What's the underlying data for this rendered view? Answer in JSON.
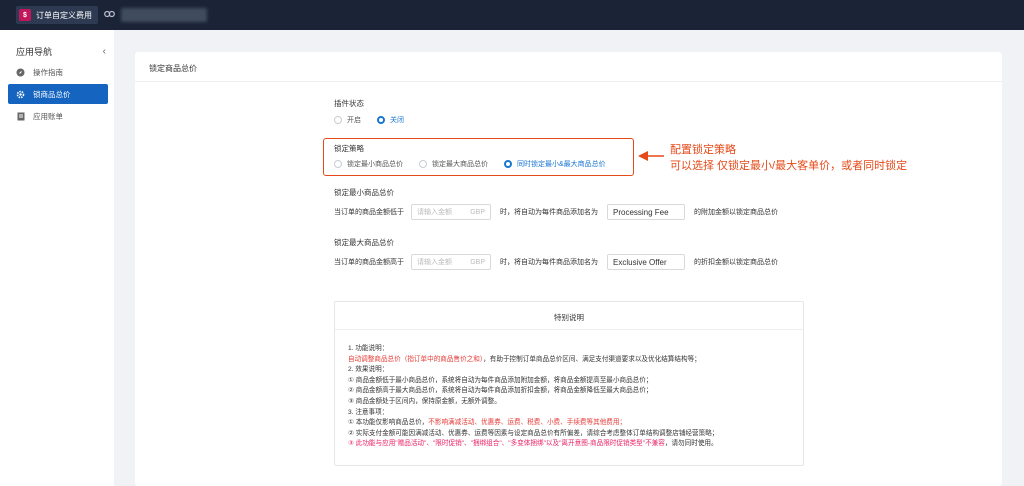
{
  "topbar": {
    "app_logo": "$",
    "app_title": "订单自定义费用",
    "link_icon": "link-icon"
  },
  "sidebar": {
    "title": "应用导航",
    "collapse_glyph": "‹",
    "items": [
      {
        "label": "操作指南",
        "icon": "guide-icon"
      },
      {
        "label": "锁商品总价",
        "icon": "gear-icon",
        "active": true
      },
      {
        "label": "应用账单",
        "icon": "bill-icon"
      }
    ]
  },
  "card": {
    "title": "锁定商品总价",
    "plugin_status": {
      "label": "插件状态",
      "options": [
        "开启",
        "关闭"
      ],
      "selected": "关闭"
    },
    "strategy": {
      "label": "锁定策略",
      "options": [
        "锁定最小商品总价",
        "锁定最大商品总价",
        "同时锁定最小&最大商品总价"
      ],
      "selected": "同时锁定最小&最大商品总价"
    },
    "min_section": {
      "label": "锁定最小商品总价",
      "prefix": "当订单的商品金额低于",
      "amount_placeholder": "请输入金额",
      "currency": "GBP",
      "middle": "时，将自动为每件商品添加名为",
      "fee_name": "Processing Fee",
      "suffix": "的附加金额以锁定商品总价"
    },
    "max_section": {
      "label": "锁定最大商品总价",
      "prefix": "当订单的商品金额高于",
      "amount_placeholder": "请输入金额",
      "currency": "GBP",
      "middle": "时，将自动为每件商品添加名为",
      "fee_name": "Exclusive Offer",
      "suffix": "的折扣金额以锁定商品总价"
    },
    "notes": {
      "title": "特别说明",
      "line1": "1. 功能说明：",
      "line2_red": "自动调整商品总价（指订单中的商品售价之和）",
      "line2_rest": "，有助于控制订单商品总价区间、满足支付渠道要求以及优化结算结构等；",
      "line3": "2. 效果说明：",
      "line4": "① 商品金额低于最小商品总价，系统将自动为每件商品添加附加金额，将商品金额提高至最小商品总价；",
      "line5": "② 商品金额高于最大商品总价，系统将自动为每件商品添加折扣金额，将商品金额降低至最大商品总价；",
      "line6": "③ 商品金额处于区间内，保持原金额，无额外调整。",
      "line7": "3. 注意事项：",
      "line8_a": "① 本功能仅影响商品总价，",
      "line8_red": "不影响满减活动、优惠券、运费、税费、小费、手续费等其他费用；",
      "line9": "② 实际支付金额可能因满减活动、优惠券、运费等因素与设定商品总价有所偏差，请综合考虑整体订单结构调整店铺经营策略；",
      "line10_pink": "③ 此功能与应用\"赠品活动\"、\"限时促销\"、\"捆绑组合\"、\"多变体捆绑\"以及\"离开意图-商品限时促销类型\"不兼容",
      "line10_rest": "，请勿同时使用。"
    }
  },
  "annotation": {
    "line1": "配置锁定策略",
    "line2": "可以选择 仅锁定最小/最大客单价，或者同时锁定",
    "color": "#e64a19"
  }
}
